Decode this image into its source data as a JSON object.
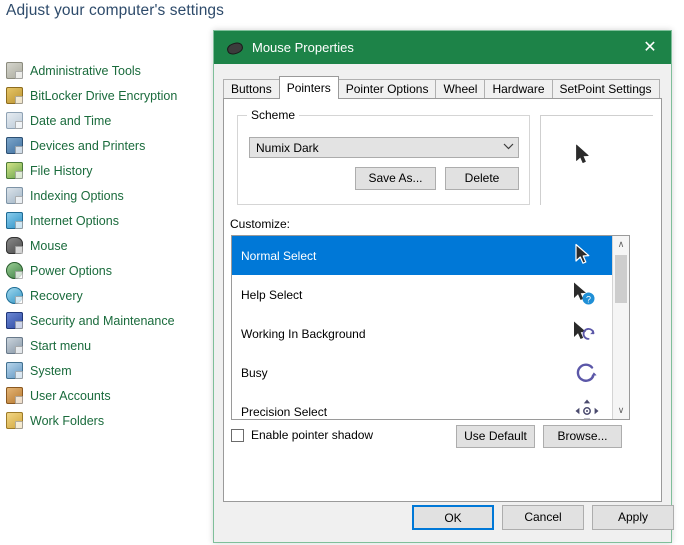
{
  "control_panel": {
    "heading": "Adjust your computer's settings",
    "items": [
      {
        "label": "Administrative Tools",
        "icon": "administrative-tools-icon"
      },
      {
        "label": "BitLocker Drive Encryption",
        "icon": "bitlocker-icon"
      },
      {
        "label": "Date and Time",
        "icon": "date-and-time-icon"
      },
      {
        "label": "Devices and Printers",
        "icon": "devices-and-printers-icon"
      },
      {
        "label": "File History",
        "icon": "file-history-icon"
      },
      {
        "label": "Indexing Options",
        "icon": "indexing-options-icon"
      },
      {
        "label": "Internet Options",
        "icon": "internet-options-icon"
      },
      {
        "label": "Mouse",
        "icon": "mouse-icon"
      },
      {
        "label": "Power Options",
        "icon": "power-options-icon"
      },
      {
        "label": "Recovery",
        "icon": "recovery-icon"
      },
      {
        "label": "Security and Maintenance",
        "icon": "security-and-maintenance-icon"
      },
      {
        "label": "Start menu",
        "icon": "start-menu-icon"
      },
      {
        "label": "System",
        "icon": "system-icon"
      },
      {
        "label": "User Accounts",
        "icon": "user-accounts-icon"
      },
      {
        "label": "Work Folders",
        "icon": "work-folders-icon"
      }
    ]
  },
  "dialog": {
    "title": "Mouse Properties",
    "title_icon": "mouse-icon",
    "close_label": "✕",
    "tabs": [
      {
        "label": "Buttons",
        "active": false
      },
      {
        "label": "Pointers",
        "active": true
      },
      {
        "label": "Pointer Options",
        "active": false
      },
      {
        "label": "Wheel",
        "active": false
      },
      {
        "label": "Hardware",
        "active": false
      },
      {
        "label": "SetPoint Settings",
        "active": false
      }
    ],
    "scheme": {
      "legend": "Scheme",
      "selected": "Numix Dark",
      "dropdown_arrow": "⌄",
      "save_as_label": "Save As...",
      "delete_label": "Delete"
    },
    "preview": {
      "cursor": "normal-select-cursor"
    },
    "customize": {
      "label": "Customize:",
      "rows": [
        {
          "label": "Normal Select",
          "cursor": "arrow-cursor",
          "selected": true
        },
        {
          "label": "Help Select",
          "cursor": "arrow-help-cursor",
          "selected": false
        },
        {
          "label": "Working In Background",
          "cursor": "arrow-busy-cursor",
          "selected": false
        },
        {
          "label": "Busy",
          "cursor": "busy-spinner-cursor",
          "selected": false
        },
        {
          "label": "Precision Select",
          "cursor": "precision-crosshair-cursor",
          "selected": false
        }
      ],
      "scroll_up": "∧",
      "scroll_down": "∨"
    },
    "pointer_shadow": {
      "label": "Enable pointer shadow",
      "checked": false
    },
    "use_default_label": "Use Default",
    "browse_label": "Browse...",
    "ok_label": "OK",
    "cancel_label": "Cancel",
    "apply_label": "Apply"
  },
  "colors": {
    "title_bar": "#1d8348",
    "selection": "#0078d7",
    "link_text": "#1a6b3c",
    "heading_text": "#2e4b6b",
    "dialog_bg": "#f0f0f0",
    "focus_border": "#0078d7"
  }
}
